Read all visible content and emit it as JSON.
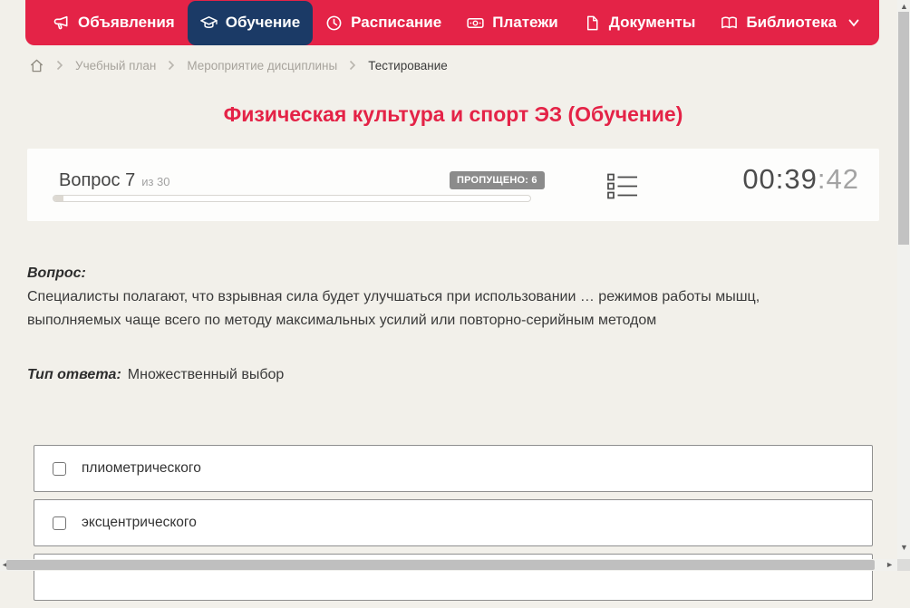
{
  "nav": {
    "items": [
      {
        "label": "Объявления",
        "icon": "megaphone-icon",
        "active": false
      },
      {
        "label": "Обучение",
        "icon": "graduation-cap-icon",
        "active": true
      },
      {
        "label": "Расписание",
        "icon": "clock-icon",
        "active": false
      },
      {
        "label": "Платежи",
        "icon": "payment-icon",
        "active": false
      },
      {
        "label": "Документы",
        "icon": "document-icon",
        "active": false
      },
      {
        "label": "Библиотека",
        "icon": "open-book-icon",
        "active": false,
        "has_dropdown": true
      }
    ]
  },
  "breadcrumb": {
    "items": [
      "Учебный план",
      "Мероприятие дисциплины",
      "Тестирование"
    ]
  },
  "page_title": "Физическая культура и спорт ЭЗ (Обучение)",
  "question_bar": {
    "question_number": "Вопрос 7",
    "question_total": "из 30",
    "skipped_badge": "ПРОПУЩЕНО: 6",
    "progress_percent": 2,
    "timer_main": "00:39",
    "timer_seconds": ":42"
  },
  "question": {
    "label": "Вопрос:",
    "text": "Специалисты полагают, что взрывная сила будет улучшаться при использовании … режимов работы мышц, выполняемых чаще всего по методу максимальных усилий или повторно-серийным методом",
    "answer_type_label": "Тип ответа:",
    "answer_type": "Множественный выбор"
  },
  "options": [
    {
      "label": "плиометрического",
      "checked": false
    },
    {
      "label": "эксцентрического",
      "checked": false
    }
  ],
  "colors": {
    "accent_red": "#e42347",
    "active_navy": "#1b3a66",
    "page_bg": "#f2f0ea",
    "badge_gray": "#8b8b8b"
  }
}
